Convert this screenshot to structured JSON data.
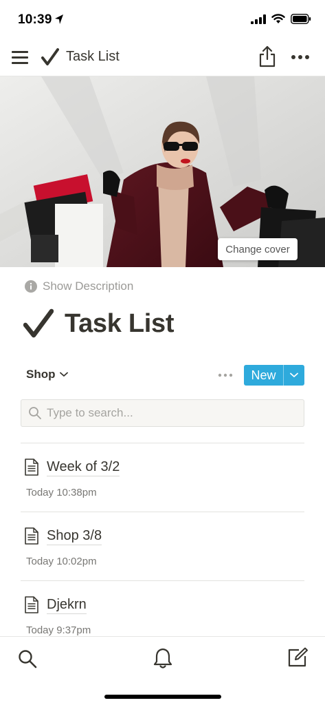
{
  "status_bar": {
    "time": "10:39"
  },
  "topnav": {
    "title": "Task List",
    "icons": [
      "menu-icon",
      "checkmark-icon",
      "share-icon",
      "more-icon"
    ]
  },
  "cover": {
    "change_cover_label": "Change cover"
  },
  "description": {
    "toggle_label": "Show Description"
  },
  "page": {
    "title": "Task List"
  },
  "view": {
    "name": "Shop",
    "new_label": "New"
  },
  "search": {
    "placeholder": "Type to search..."
  },
  "items": [
    {
      "title": "Week of 3/2",
      "time": "Today 10:38pm"
    },
    {
      "title": "Shop 3/8",
      "time": "Today 10:02pm"
    },
    {
      "title": "Djekrn",
      "time": "Today 9:37pm"
    }
  ],
  "colors": {
    "accent": "#2eaadc",
    "text": "#37352f",
    "muted": "#9b9a97"
  }
}
